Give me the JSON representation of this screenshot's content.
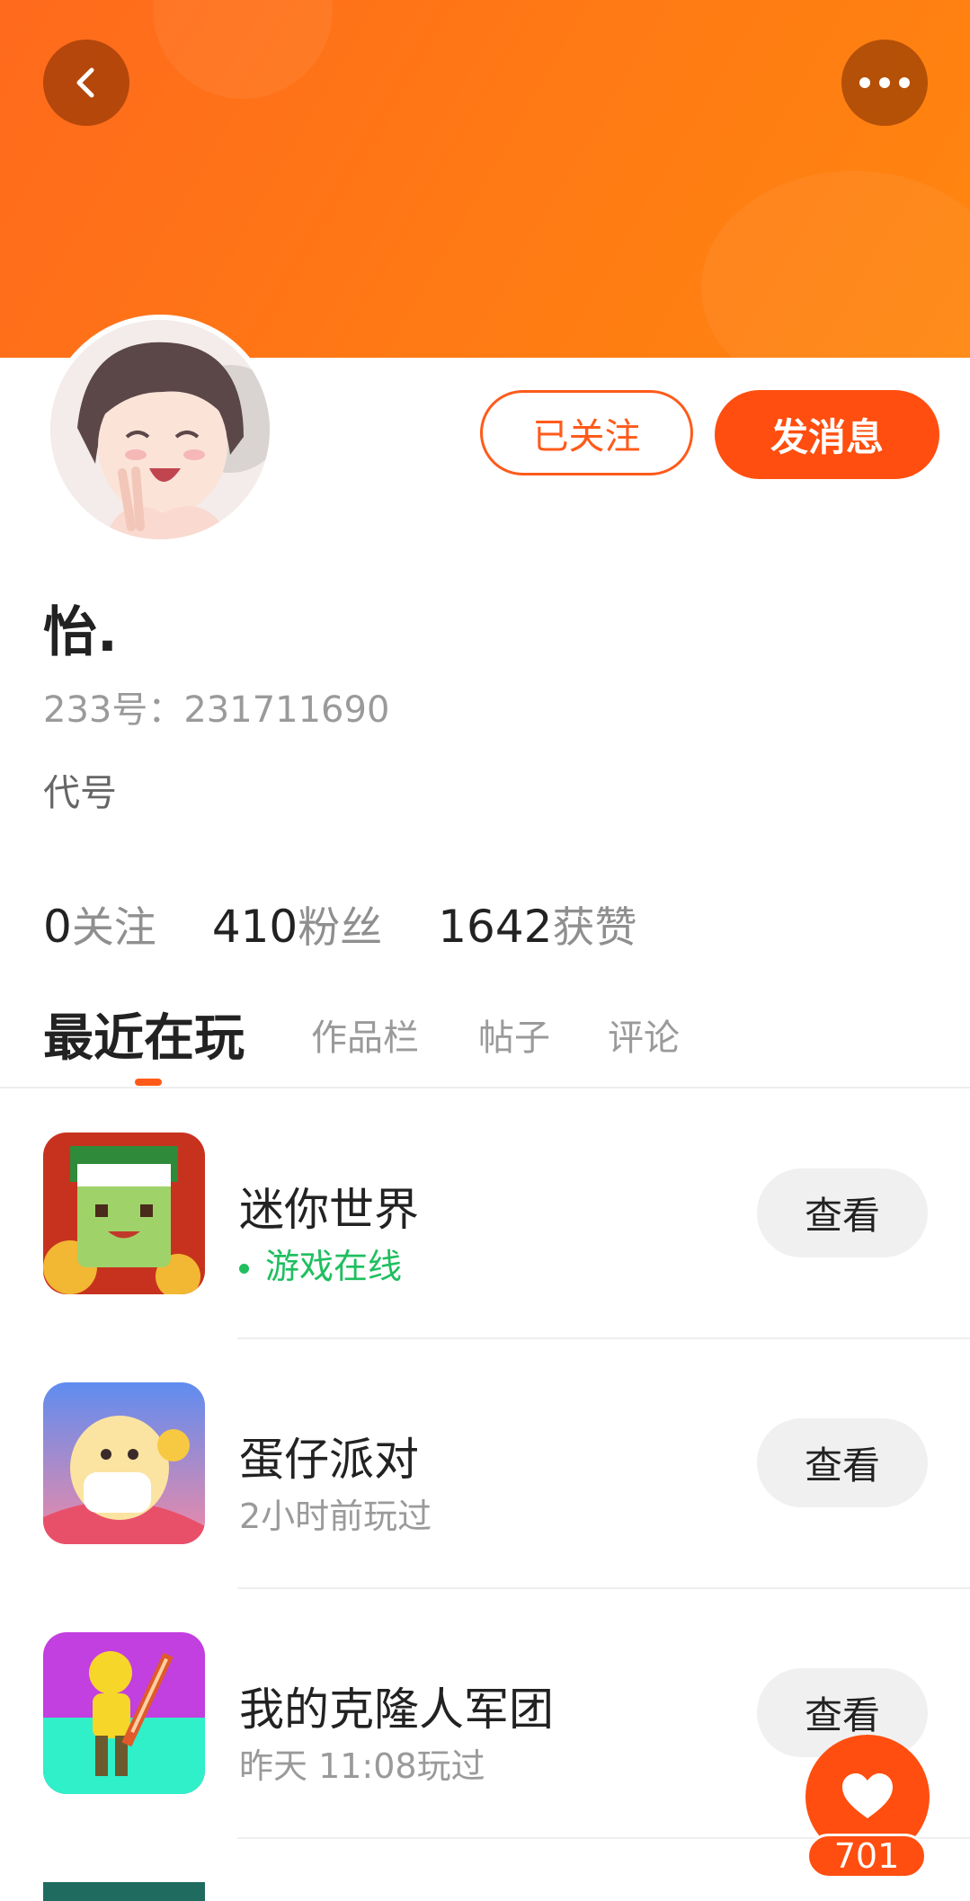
{
  "header": {
    "back_icon": "chevron-left-icon",
    "more_icon": "more-horizontal-icon",
    "banner_color": "#ff7a14"
  },
  "profile": {
    "follow_status_label": "已关注",
    "message_button_label": "发消息",
    "nickname": "怡.",
    "uid_text": "233号：231711690",
    "bio": "代号",
    "accent_color": "#ff4e0f"
  },
  "stats": [
    {
      "count": "0",
      "label": "关注"
    },
    {
      "count": "410",
      "label": "粉丝"
    },
    {
      "count": "1642",
      "label": "获赞"
    }
  ],
  "tabs": [
    {
      "label": "最近在玩",
      "active": true
    },
    {
      "label": "作品栏",
      "active": false
    },
    {
      "label": "帖子",
      "active": false
    },
    {
      "label": "评论",
      "active": false
    }
  ],
  "games": [
    {
      "name": "迷你世界",
      "status": "游戏在线",
      "online": true,
      "button_label": "查看"
    },
    {
      "name": "蛋仔派对",
      "status": "2小时前玩过",
      "online": false,
      "button_label": "查看"
    },
    {
      "name": "我的克隆人军团",
      "status": "昨天 11:08玩过",
      "online": false,
      "button_label": "查看"
    }
  ],
  "floating_like": {
    "icon": "heart-icon",
    "count": "701"
  }
}
